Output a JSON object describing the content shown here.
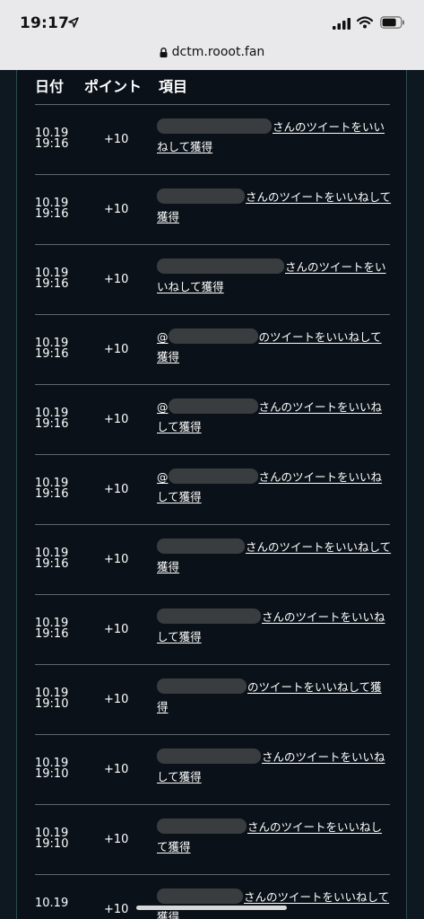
{
  "status_bar": {
    "time": "19:17"
  },
  "browser": {
    "url": "dctm.rooot.fan"
  },
  "table": {
    "headers": {
      "date": "日付",
      "points": "ポイント",
      "item": "項目"
    },
    "rows": [
      {
        "date": "10.19",
        "time": "19:16",
        "points": "+10",
        "prefix": "",
        "redact": 128,
        "text": "さんのツイートをいいねして獲得"
      },
      {
        "date": "10.19",
        "time": "19:16",
        "points": "+10",
        "prefix": "",
        "redact": 98,
        "text": "さんのツイートをいいねして獲得"
      },
      {
        "date": "10.19",
        "time": "19:16",
        "points": "+10",
        "prefix": "",
        "redact": 142,
        "text": "さんのツイートをいいねして獲得"
      },
      {
        "date": "10.19",
        "time": "19:16",
        "points": "+10",
        "prefix": "@",
        "redact": 100,
        "text": "のツイートをいいねして獲得"
      },
      {
        "date": "10.19",
        "time": "19:16",
        "points": "+10",
        "prefix": "@",
        "redact": 100,
        "text": "さんのツイートをいいねして獲得"
      },
      {
        "date": "10.19",
        "time": "19:16",
        "points": "+10",
        "prefix": "@",
        "redact": 100,
        "text": "さんのツイートをいいねして獲得"
      },
      {
        "date": "10.19",
        "time": "19:16",
        "points": "+10",
        "prefix": "",
        "redact": 98,
        "text": "さんのツイートをいいねして獲得"
      },
      {
        "date": "10.19",
        "time": "19:16",
        "points": "+10",
        "prefix": "",
        "redact": 116,
        "text": "さんのツイートをいいねして獲得"
      },
      {
        "date": "10.19",
        "time": "19:10",
        "points": "+10",
        "prefix": "",
        "redact": 100,
        "text": "のツイートをいいねして獲得"
      },
      {
        "date": "10.19",
        "time": "19:10",
        "points": "+10",
        "prefix": "",
        "redact": 116,
        "text": "さんのツイートをいいねして獲得"
      },
      {
        "date": "10.19",
        "time": "19:10",
        "points": "+10",
        "prefix": "",
        "redact": 100,
        "text": "さんのツイートをいいねして獲得"
      },
      {
        "date": "10.19",
        "time": "",
        "points": "+10",
        "prefix": "",
        "redact": 96,
        "text": "さんのツイートをいいねして獲得"
      }
    ]
  }
}
